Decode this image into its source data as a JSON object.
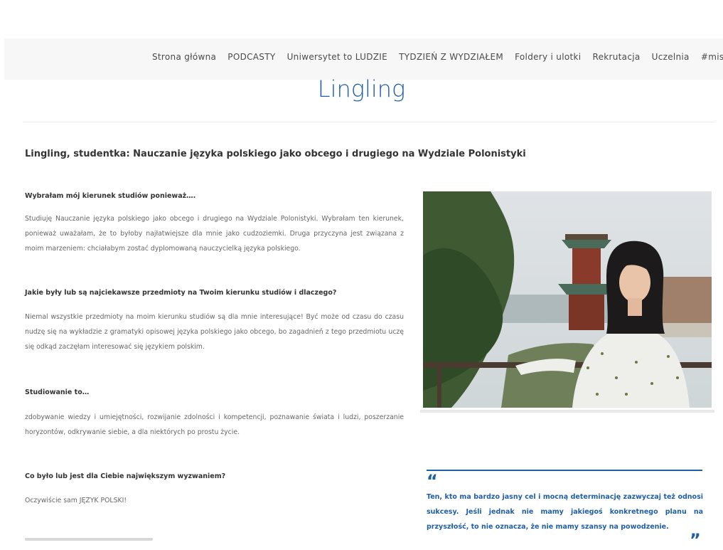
{
  "nav": {
    "items": [
      "Strona główna",
      "PODCASTY",
      "Uniwersytet to LUDZIE",
      "TYDZIEŃ Z WYDZIAŁEM",
      "Foldery i ulotki",
      "Rekrutacja",
      "Uczelnia",
      "#misjaU."
    ]
  },
  "page": {
    "title": "Lingling",
    "subtitle": "Lingling, studentka: Nauczanie języka polskiego jako obcego i drugiego na Wydziale Polonistyki"
  },
  "qa": [
    {
      "question": "Wybrałam mój kierunek studiów ponieważ….",
      "answer": "Studiuję Nauczanie języka polskiego jako obcego i drugiego na Wydziale Polonistyki. Wybrałam ten kierunek, ponieważ uważałam, że to byłoby najłatwiejsze dla mnie jako cudzoziemki. Druga przyczyna jest związana z moim marzeniem: chciałabym zostać dyplomowaną nauczycielką języka polskiego."
    },
    {
      "question": "Jakie były lub są najciekawsze przedmioty na Twoim kierunku studiów i dlaczego?",
      "answer": "Niemal wszystkie przedmioty na moim kierunku studiów są dla mnie interesujące! Być może od czasu do czasu nudzę się na wykładzie z gramatyki opisowej języka polskiego jako obcego, bo zagadnień z tego przedmiotu uczę się odkąd zaczęłam interesować się językiem polskim."
    },
    {
      "question": "Studiowanie to…",
      "answer": "zdobywanie wiedzy i umiejętności, rozwijanie zdolności i kompetencji, poznawanie świata i ludzi, poszerzanie horyzontów, odkrywanie siebie, a dla niektórych po prostu życie."
    },
    {
      "question": "Co było lub jest dla Ciebie największym wyzwaniem?",
      "answer": "Oczywiście sam JĘZYK POLSKI!"
    }
  ],
  "quote": {
    "open_mark": "“",
    "close_mark": "”",
    "text": "Ten, kto ma bardzo jasny cel i mocną determinację zazwyczaj też odnosi sukcesy. Jeśli jednak nie mamy jakiegoś konkretnego planu na przyszłość, to nie oznacza, że nie mamy szansy na powodzenie."
  },
  "colors": {
    "accent": "#1f5fa8",
    "nav_bg": "#f7f7f7"
  }
}
